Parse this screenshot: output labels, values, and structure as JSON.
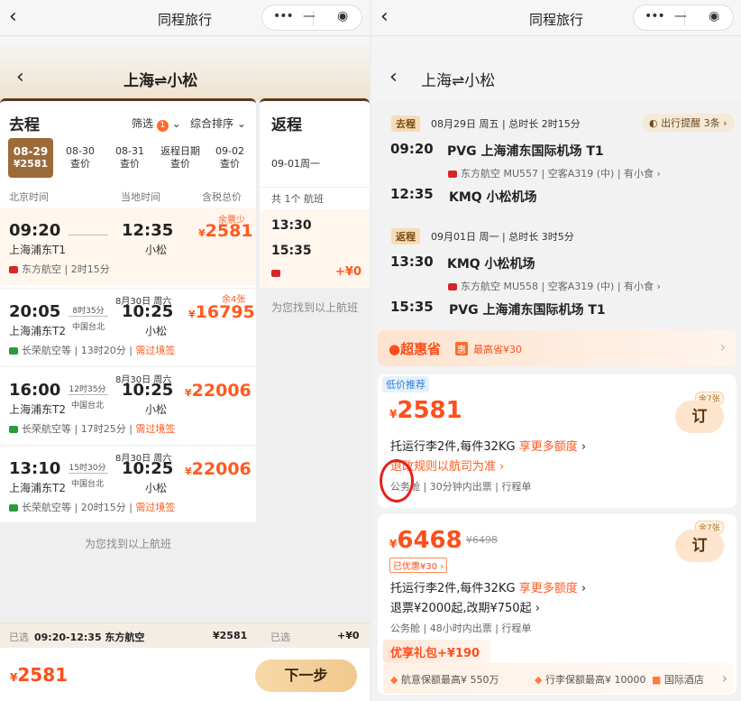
{
  "miniapp_title": "同程旅行",
  "route_title": "上海⇌小松",
  "left": {
    "outbound_title": "去程",
    "filter_label": "筛选",
    "filter_count": "1",
    "sort_label": "综合排序",
    "dates": [
      {
        "date": "08-29",
        "sub": "¥2581",
        "selected": true
      },
      {
        "date": "08-30",
        "sub": "查价"
      },
      {
        "date": "08-31",
        "sub": "查价"
      },
      {
        "date": "返程日期",
        "sub": "查价"
      },
      {
        "date": "09-02",
        "sub": "查价"
      }
    ],
    "col_headers": {
      "beijing": "北京时间",
      "local": "当地时间",
      "price": "含税总价"
    },
    "flights": [
      {
        "dep": "09:20",
        "dep_ap": "上海浦东T1",
        "arr": "12:35",
        "arr_ap": "小松",
        "price": "2581",
        "tag": "余票少",
        "airline": "东方航空",
        "duration": "2时15分",
        "stop": "",
        "stop_city": "",
        "next_day": "",
        "visa": ""
      },
      {
        "dep": "20:05",
        "dep_ap": "上海浦东T2",
        "arr": "10:25",
        "arr_ap": "小松",
        "price": "16795",
        "tag": "余4张",
        "airline": "长荣航空等",
        "duration": "13时20分",
        "stop": "8时35分",
        "stop_city": "中国台北",
        "next_day": "8月30日 周六",
        "visa": "需过境签"
      },
      {
        "dep": "16:00",
        "dep_ap": "上海浦东T2",
        "arr": "10:25",
        "arr_ap": "小松",
        "price": "22006",
        "tag": "",
        "airline": "长荣航空等",
        "duration": "17时25分",
        "stop": "12时35分",
        "stop_city": "中国台北",
        "next_day": "8月30日 周六",
        "visa": "需过境签"
      },
      {
        "dep": "13:10",
        "dep_ap": "上海浦东T2",
        "arr": "10:25",
        "arr_ap": "小松",
        "price": "22006",
        "tag": "",
        "airline": "长荣航空等",
        "duration": "20时15分",
        "stop": "15时30分",
        "stop_city": "中国台北",
        "next_day": "8月30日 周六",
        "visa": "需过境签"
      }
    ],
    "found_text": "为您找到以上航班",
    "selected_label": "已选",
    "selected_value": "09:20-12:35 东方航空",
    "selected_price": "¥2581",
    "total_price": "2581",
    "next_button": "下一步",
    "return_title": "返程",
    "return_date": "09-01周一",
    "return_count_prefix": "共",
    "return_count": "1个 航班",
    "return_dep": "13:30",
    "return_arr": "15:35",
    "return_price": "+¥0",
    "return_found": "为您找到以上航班",
    "return_selected_label": "已选",
    "return_selected_price": "+¥0"
  },
  "right": {
    "reminder": "出行提醒 3条",
    "outbound": {
      "pill": "去程",
      "date": "08月29日 周五",
      "duration": "总时长 2时15分",
      "dep_time": "09:20",
      "dep_ap": "PVG 上海浦东国际机场 T1",
      "info": "东方航空 MU557 | 空客A319 (中) | 有小食",
      "arr_time": "12:35",
      "arr_ap": "KMQ 小松机场"
    },
    "return": {
      "pill": "返程",
      "date": "09月01日 周一",
      "duration": "总时长 3时5分",
      "dep_time": "13:30",
      "dep_ap": "KMQ 小松机场",
      "info": "东方航空 MU558 | 空客A319 (中) | 有小食",
      "arr_time": "15:35",
      "arr_ap": "PVG 上海浦东国际机场 T1"
    },
    "promo": {
      "name": "超惠省",
      "badge": "惠",
      "text": "最高省¥30"
    },
    "offer1": {
      "tag": "低价推荐",
      "price": "2581",
      "remain": "余7张",
      "book": "订",
      "baggage": "托运行李2件,每件32KG",
      "more": "享更多额度",
      "refund": "退改规则以航司为准",
      "cabin": "公务舱",
      "ticket": "30分钟内出票",
      "itinerary": "行程单"
    },
    "offer2": {
      "price": "6468",
      "old_price": "¥6498",
      "remain": "余7张",
      "book": "订",
      "discount": "已优惠¥30",
      "baggage": "托运行李2件,每件32KG",
      "more": "享更多额度",
      "refund": "退票¥2000起,改期¥750起",
      "cabin": "公务舱",
      "ticket": "48小时内出票",
      "itinerary": "行程单",
      "gift": "优享礼包+¥190",
      "gift_items": [
        "航意保额最高¥ 550万",
        "行李保额最高¥ 10000",
        "国际酒店"
      ]
    }
  },
  "colors": {
    "accent": "#ff5a1f",
    "brand_brown": "#9b6b3a",
    "highlight_circle": "#e8201a"
  }
}
